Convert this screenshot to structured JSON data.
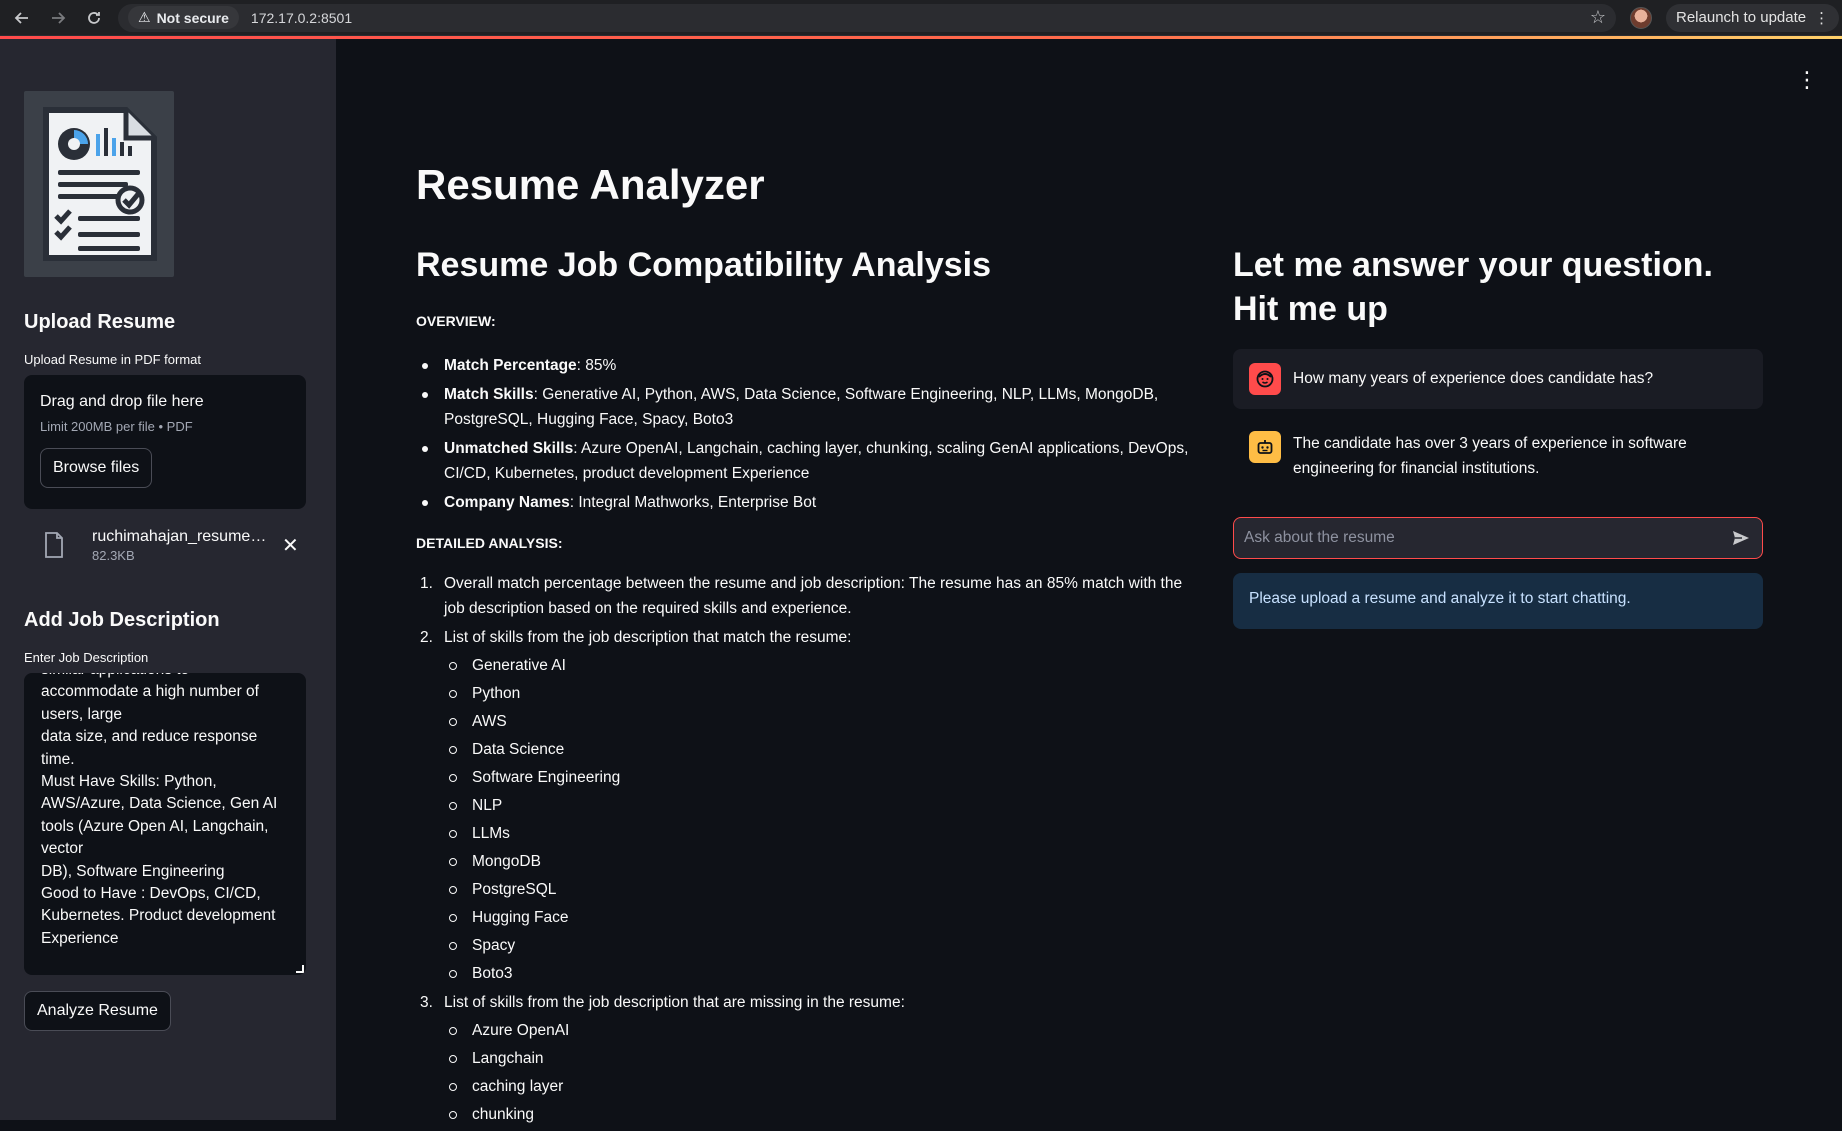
{
  "browser": {
    "not_secure_label": "Not secure",
    "url": "172.17.0.2:8501",
    "relaunch_label": "Relaunch to update"
  },
  "sidebar": {
    "upload_header": "Upload Resume",
    "upload_label": "Upload Resume in PDF format",
    "drop_title": "Drag and drop file here",
    "drop_limit": "Limit 200MB per file • PDF",
    "browse_label": "Browse files",
    "file_name": "ruchimahajan_resume_...",
    "file_size": "82.3KB",
    "job_header": "Add Job Description",
    "job_label": "Enter Job Description",
    "job_text": "similar applications to\naccommodate a high number of\nusers, large\ndata size, and reduce response\ntime.\nMust Have Skills: Python,\nAWS/Azure, Data Science, Gen AI\ntools (Azure Open AI, Langchain,\nvector\nDB), Software Engineering\nGood to Have : DevOps, CI/CD,\nKubernetes. Product development\nExperience",
    "analyze_label": "Analyze Resume"
  },
  "main": {
    "title": "Resume Analyzer",
    "analysis_heading": "Resume Job Compatibility Analysis",
    "overview_label": "OVERVIEW:",
    "overview": [
      {
        "key": "Match Percentage",
        "value": ": 85%"
      },
      {
        "key": "Match Skills",
        "value": ": Generative AI, Python, AWS, Data Science, Software Engineering, NLP, LLMs, MongoDB, PostgreSQL, Hugging Face, Spacy, Boto3"
      },
      {
        "key": "Unmatched Skills",
        "value": ": Azure OpenAI, Langchain, caching layer, chunking, scaling GenAI applications, DevOps, CI/CD, Kubernetes, product development Experience"
      },
      {
        "key": "Company Names",
        "value": ": Integral Mathworks, Enterprise Bot"
      }
    ],
    "detailed_label": "DETAILED ANALYSIS:",
    "detailed": [
      {
        "num": "1.",
        "text": "Overall match percentage between the resume and job description: The resume has an 85% match with the job description based on the required skills and experience."
      },
      {
        "num": "2.",
        "text": "List of skills from the job description that match the resume:"
      },
      {
        "num": "3.",
        "text": "List of skills from the job description that are missing in the resume:"
      }
    ],
    "matched_skills": [
      "Generative AI",
      "Python",
      "AWS",
      "Data Science",
      "Software Engineering",
      "NLP",
      "LLMs",
      "MongoDB",
      "PostgreSQL",
      "Hugging Face",
      "Spacy",
      "Boto3"
    ],
    "missing_skills": [
      "Azure OpenAI",
      "Langchain",
      "caching layer",
      "chunking"
    ]
  },
  "chat": {
    "heading": "Let me answer your question. Hit me up",
    "user_message": "How many years of experience does candidate has?",
    "bot_message": "The candidate has over 3 years of experience in software engineering for financial institutions.",
    "input_placeholder": "Ask about the resume",
    "info": "Please upload a resume and analyze it to start chatting."
  },
  "colors": {
    "accent": "#ff4b4b",
    "bot_avatar": "#ffbd45",
    "info_bg": "#172d43",
    "sidebar_bg": "#262730",
    "main_bg": "#0e1117"
  },
  "icons": [
    "back-arrow-icon",
    "forward-arrow-icon",
    "reload-icon",
    "warning-icon",
    "star-icon",
    "kebab-menu-icon",
    "document-file-icon",
    "close-icon",
    "user-face-icon",
    "bot-icon",
    "send-icon",
    "resume-logo"
  ]
}
